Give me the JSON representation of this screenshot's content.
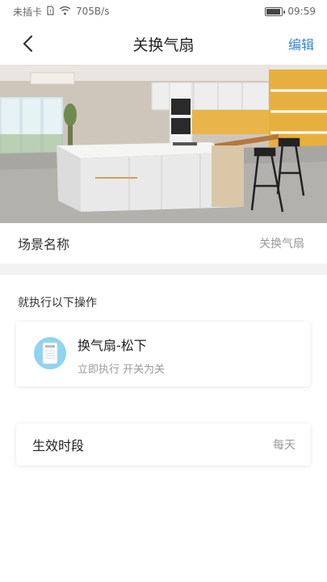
{
  "status_bar": {
    "carrier": "未插卡",
    "speed": "705B/s",
    "time": "09:59"
  },
  "header": {
    "title": "关换气扇",
    "edit_label": "编辑"
  },
  "scene_name": {
    "label": "场景名称",
    "value": "关换气扇"
  },
  "actions_section": {
    "title": "就执行以下操作",
    "items": [
      {
        "device": "换气扇-松下",
        "detail": "立即执行 开关为关"
      }
    ]
  },
  "effective_period": {
    "label": "生效时段",
    "value": "每天"
  },
  "colors": {
    "accent": "#3a87c8",
    "device_icon_bg": "#8fd4f0"
  }
}
